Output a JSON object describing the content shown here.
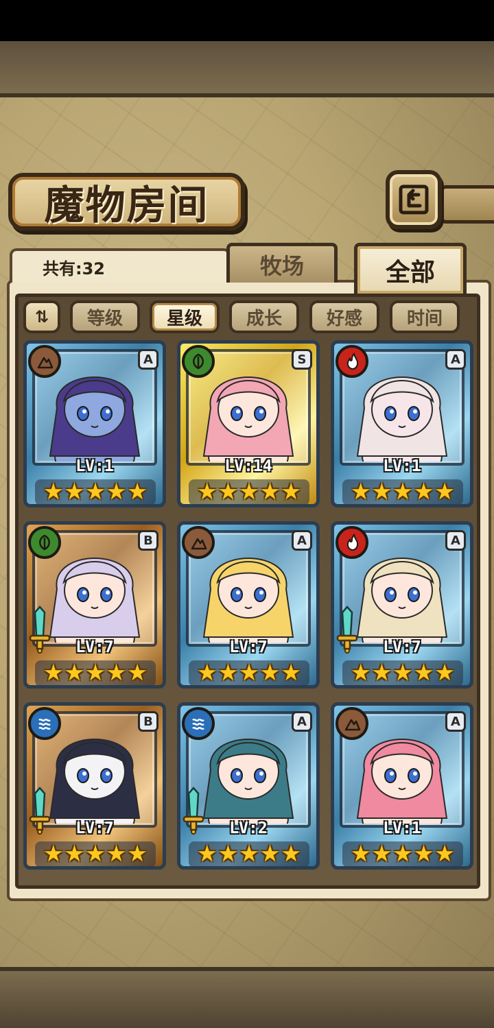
{
  "screen": {
    "title": "魔物房间",
    "count_label": "共有:32",
    "tabs": [
      {
        "label": "牧场",
        "active": false
      },
      {
        "label": "全部",
        "active": true
      }
    ],
    "sort_buttons": [
      {
        "label": "等级",
        "active": false
      },
      {
        "label": "星级",
        "active": true
      },
      {
        "label": "成长",
        "active": false
      },
      {
        "label": "好感",
        "active": false
      },
      {
        "label": "时间",
        "active": false
      }
    ],
    "sort_toggle_icon": "sort-order-icon"
  },
  "monsters": [
    {
      "level": "LV:1",
      "rank": "A",
      "element": "earth",
      "stars": 5,
      "equipped_weapon": false,
      "hair": "#4a3c8a",
      "skin": "#8fa8e0"
    },
    {
      "level": "LV:14",
      "rank": "S",
      "element": "leaf",
      "stars": 5,
      "equipped_weapon": false,
      "hair": "#f3a6b4",
      "skin": "#fde7dc"
    },
    {
      "level": "LV:1",
      "rank": "A",
      "element": "fire",
      "stars": 5,
      "equipped_weapon": false,
      "hair": "#f0e4e4",
      "skin": "#f6e6ea"
    },
    {
      "level": "LV:7",
      "rank": "B",
      "element": "leaf",
      "stars": 5,
      "equipped_weapon": true,
      "hair": "#d9cdec",
      "skin": "#fde7dc"
    },
    {
      "level": "LV:7",
      "rank": "A",
      "element": "earth",
      "stars": 5,
      "equipped_weapon": false,
      "hair": "#f6d46a",
      "skin": "#fde7dc"
    },
    {
      "level": "LV:7",
      "rank": "A",
      "element": "fire",
      "stars": 5,
      "equipped_weapon": true,
      "hair": "#efe2c0",
      "skin": "#fde7dc"
    },
    {
      "level": "LV:7",
      "rank": "B",
      "element": "water",
      "stars": 5,
      "equipped_weapon": true,
      "hair": "#2c2f44",
      "skin": "#f3f3f6"
    },
    {
      "level": "LV:2",
      "rank": "A",
      "element": "water",
      "stars": 5,
      "equipped_weapon": true,
      "hair": "#3c7c88",
      "skin": "#fde7dc"
    },
    {
      "level": "LV:1",
      "rank": "A",
      "element": "earth",
      "stars": 5,
      "equipped_weapon": false,
      "hair": "#f08aa0",
      "skin": "#fde7dc"
    }
  ],
  "colors": {
    "accent": "#3e3020",
    "panel": "#f0e5c8",
    "star": "#ffc81e"
  }
}
